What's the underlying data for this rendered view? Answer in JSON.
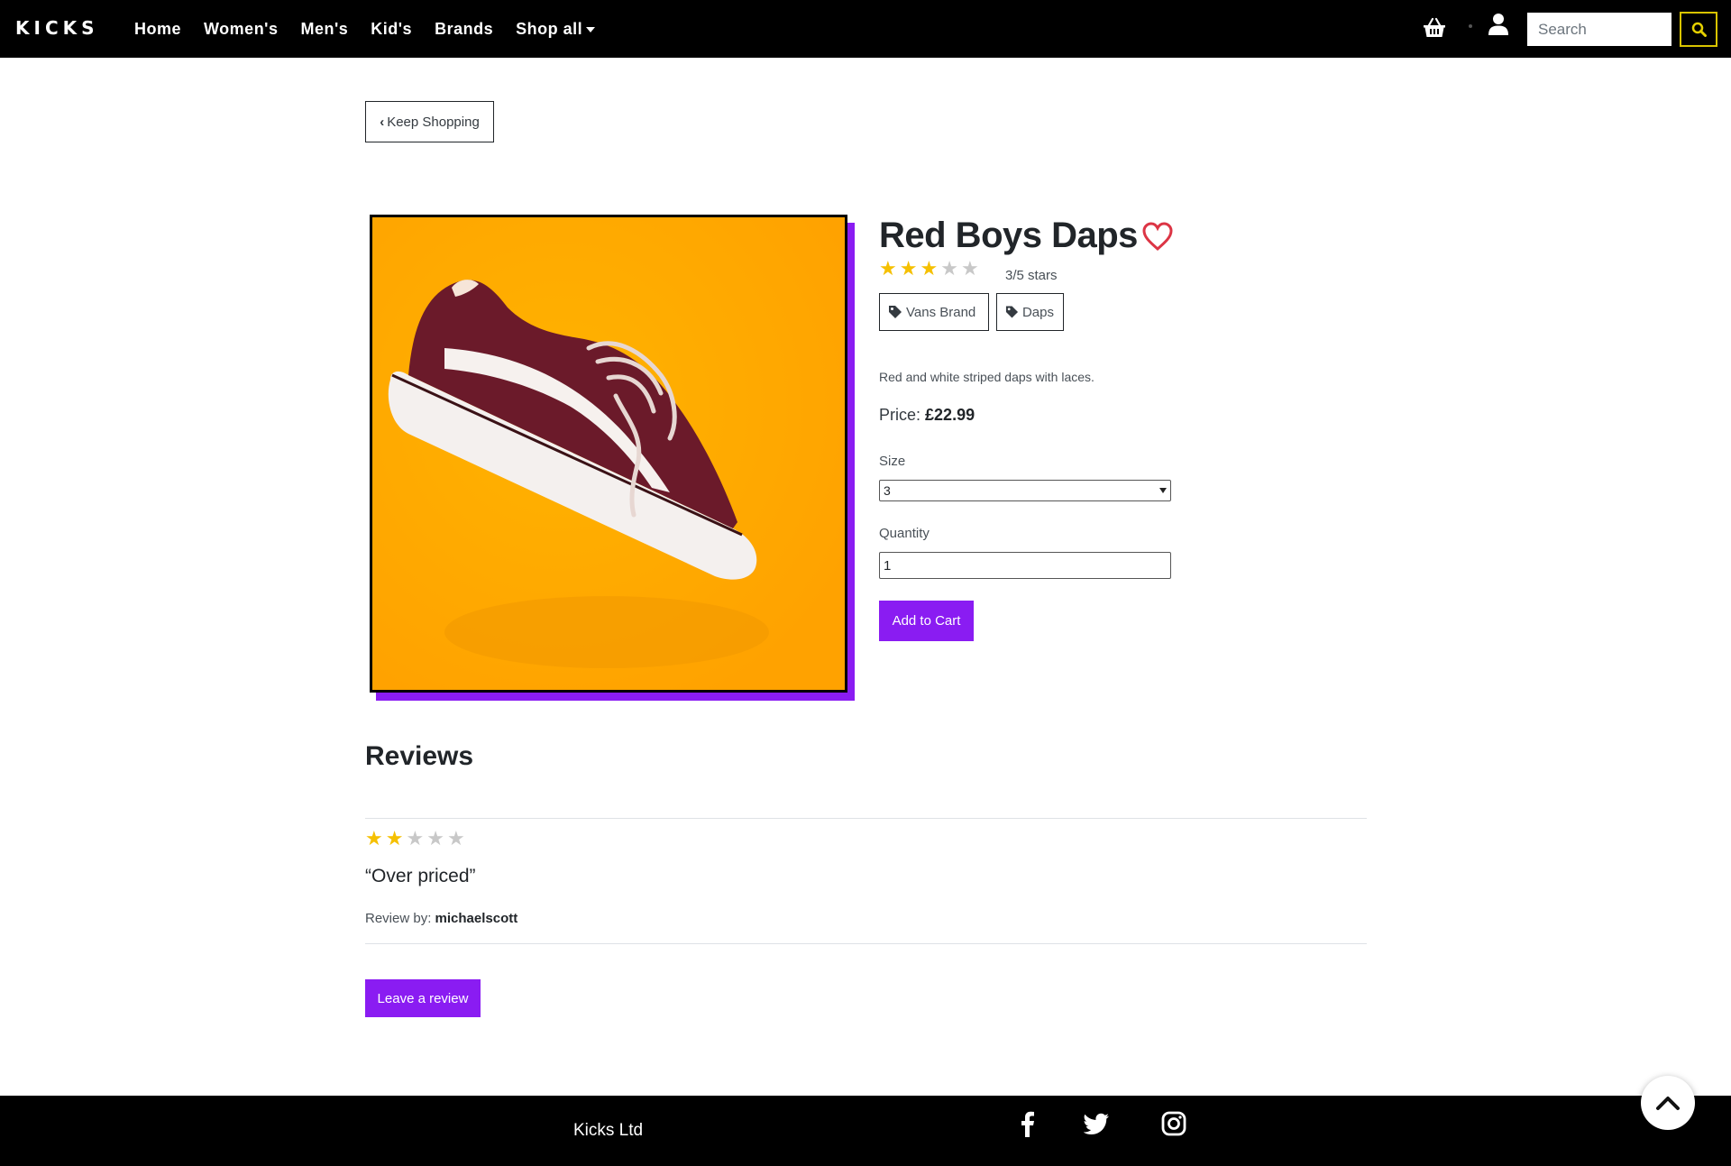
{
  "navbar": {
    "logo": "KICKS",
    "links": [
      "Home",
      "Women's",
      "Men's",
      "Kid's",
      "Brands",
      "Shop all"
    ],
    "search_placeholder": "Search",
    "icons": {
      "basket": "basket-icon",
      "user": "user-icon",
      "search": "search-icon"
    }
  },
  "back_button": {
    "label": "Keep Shopping",
    "icon": "chevron-left-icon"
  },
  "product": {
    "name": "Red Boys Daps",
    "favorite_icon": "heart-outline-icon",
    "rating": 3,
    "rating_max": 5,
    "rating_text": "3/5 stars",
    "tags": [
      "Vans Brand",
      "Daps"
    ],
    "tag_icon": "tag-icon",
    "description": "Red and white striped daps with laces.",
    "price_label": "Price:",
    "price_value": "£22.99",
    "size_label": "Size",
    "size_value": "3",
    "quantity_label": "Quantity",
    "quantity_value": "1",
    "add_to_cart": "Add to Cart"
  },
  "reviews": {
    "title": "Reviews",
    "items": [
      {
        "rating": 2,
        "rating_max": 5,
        "text": "“Over priced”",
        "by_label": "Review by:",
        "author": "michaelscott"
      }
    ],
    "leave_review": "Leave a review"
  },
  "footer": {
    "text": "Kicks Ltd",
    "social": [
      "facebook-icon",
      "twitter-icon",
      "instagram-icon"
    ]
  },
  "colors": {
    "accent": "#8a1cf2",
    "star": "#f5c000",
    "heart": "#dc3545",
    "image_bg": "#ffab00"
  }
}
